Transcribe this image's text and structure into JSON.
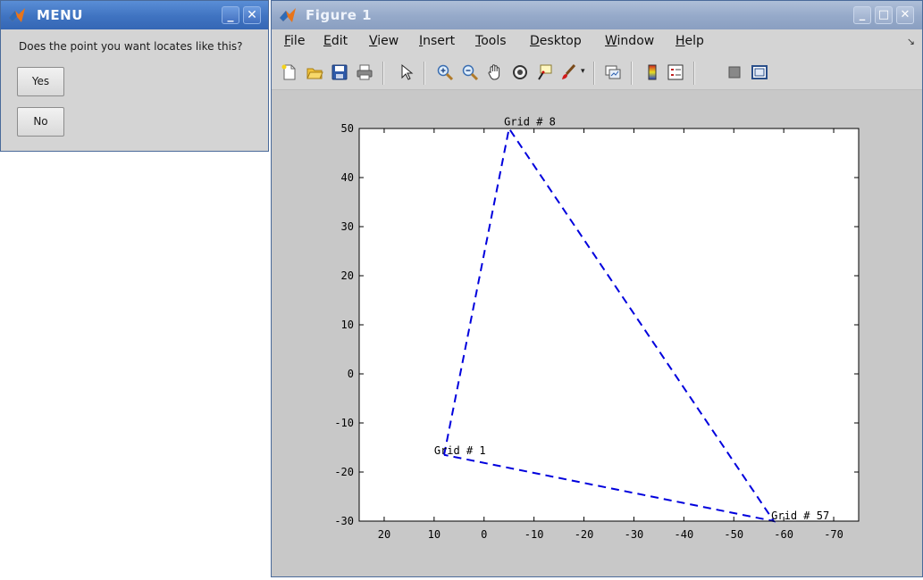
{
  "menu_window": {
    "title": "MENU",
    "question": "Does the point you want locates like this?",
    "buttons": {
      "yes": "Yes",
      "no": "No"
    }
  },
  "figure_window": {
    "title": "Figure 1",
    "menu": [
      "File",
      "Edit",
      "View",
      "Insert",
      "Tools",
      "Desktop",
      "Window",
      "Help"
    ],
    "toolbar_icons": [
      "new-figure-icon",
      "open-file-icon",
      "save-icon",
      "print-icon",
      "pointer-icon",
      "zoom-in-icon",
      "zoom-out-icon",
      "pan-hand-icon",
      "rotate-3d-icon",
      "data-cursor-icon",
      "brush-icon",
      "link-plot-icon",
      "colorbar-icon",
      "legend-icon",
      "hide-tools-icon",
      "show-tools-icon"
    ]
  },
  "chart_data": {
    "type": "line",
    "title": "",
    "xlabel": "",
    "ylabel": "",
    "xlim": [
      25,
      -75
    ],
    "ylim": [
      -30,
      50
    ],
    "x_reversed": true,
    "x_ticks": [
      20,
      10,
      0,
      -10,
      -20,
      -30,
      -40,
      -50,
      -60,
      -70
    ],
    "y_ticks": [
      50,
      40,
      30,
      20,
      10,
      0,
      -10,
      -20,
      -30
    ],
    "series": [
      {
        "style": "dashed",
        "color": "#0000dd",
        "x": [
          8,
          -5,
          -58,
          8
        ],
        "y": [
          -16.5,
          50,
          -30,
          -16.5
        ]
      }
    ],
    "annotations": [
      {
        "text": "Grid # 8",
        "x": -4,
        "y": 50.6
      },
      {
        "text": "Grid # 1",
        "x": 10,
        "y": -16.4
      },
      {
        "text": "Grid # 57",
        "x": -57.5,
        "y": -29.6
      }
    ]
  }
}
